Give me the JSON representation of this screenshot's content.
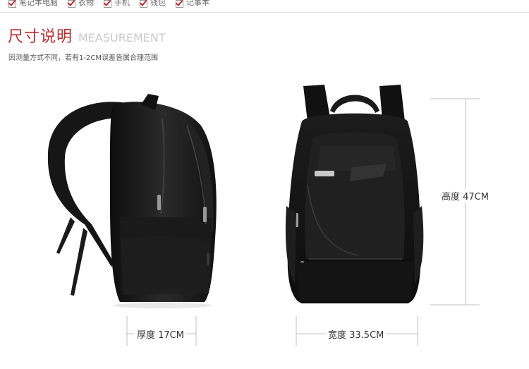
{
  "top_checklist": [
    {
      "label": "笔记本电脑"
    },
    {
      "label": "衣物"
    },
    {
      "label": "手机"
    },
    {
      "label": "钱包"
    },
    {
      "label": "记事本"
    }
  ],
  "header": {
    "title_cn": "尺寸说明",
    "title_en": "MEASUREMENT",
    "note": "因测量方式不同，若有1-2CM误差皆属合理范围"
  },
  "measurements": {
    "thickness": "厚度 17CM",
    "width": "宽度 33.5CM",
    "height": "高度 47CM"
  },
  "colors": {
    "accent": "#c0282d",
    "bag": "#151515"
  }
}
